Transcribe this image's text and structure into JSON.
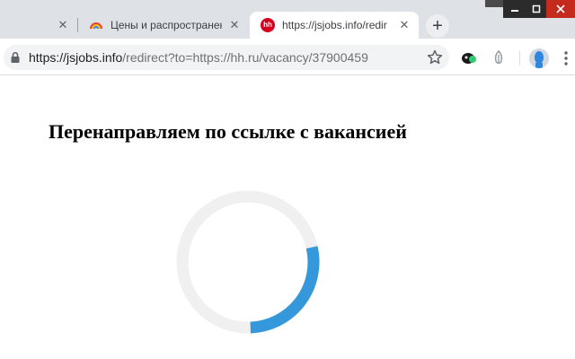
{
  "tabs": [
    {
      "label": "",
      "close": "✕"
    },
    {
      "label": "Цены и распространен",
      "close": "✕"
    },
    {
      "label": "https://jsjobs.info/redir",
      "close": "✕",
      "favicon_text": "hh",
      "active": true
    }
  ],
  "new_tab": "+",
  "omnibox": {
    "domain": "https://jsjobs.info",
    "path": "/redirect?to=https://hh.ru/vacancy/37900459"
  },
  "page": {
    "heading": "Перенаправляем по ссылке с вакансией"
  },
  "spinner": {
    "progress_fraction": 0.28,
    "track_color": "#f0f0f0",
    "arc_color": "#3498db"
  },
  "colors": {
    "tabstrip": "#dee1e6",
    "active_tab": "#ffffff",
    "hh_brand": "#d6001c",
    "window_close": "#c42b1c"
  },
  "icons": [
    "lock-icon",
    "star-icon",
    "extension-icon",
    "extension-icon",
    "avatar",
    "kebab-menu-icon"
  ]
}
